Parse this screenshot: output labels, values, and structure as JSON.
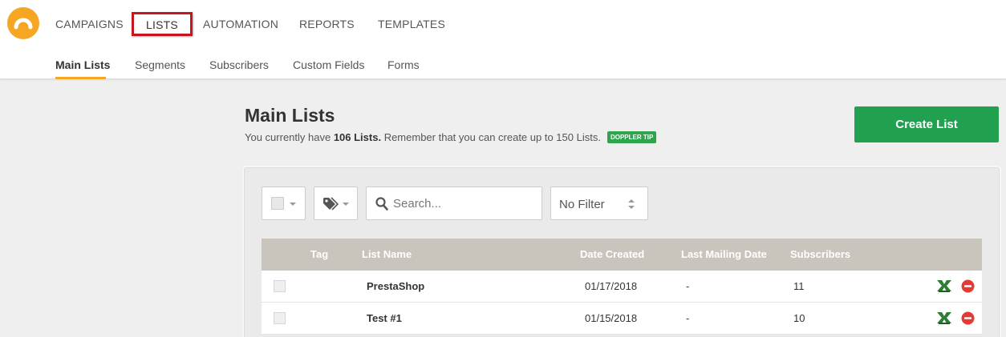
{
  "nav": {
    "items": [
      {
        "label": "CAMPAIGNS"
      },
      {
        "label": "LISTS"
      },
      {
        "label": "AUTOMATION"
      },
      {
        "label": "REPORTS"
      },
      {
        "label": "TEMPLATES"
      }
    ],
    "active": "LISTS"
  },
  "subnav": {
    "items": [
      {
        "label": "Main Lists"
      },
      {
        "label": "Segments"
      },
      {
        "label": "Subscribers"
      },
      {
        "label": "Custom Fields"
      },
      {
        "label": "Forms"
      }
    ],
    "active": "Main Lists"
  },
  "page": {
    "title": "Main Lists",
    "desc_prefix": "You currently have ",
    "desc_count": "106 Lists.",
    "desc_suffix": " Remember that you can create up to 150 Lists.",
    "tip_badge": "DOPPLER TIP",
    "create_button": "Create List"
  },
  "toolbar": {
    "search_placeholder": "Search...",
    "filter_value": "No Filter"
  },
  "table": {
    "headers": {
      "tag": "Tag",
      "name": "List Name",
      "date_created": "Date Created",
      "last_mailing": "Last Mailing Date",
      "subscribers": "Subscribers"
    },
    "rows": [
      {
        "name": "PrestaShop",
        "date_created": "01/17/2018",
        "last_mailing": "-",
        "subscribers": "11"
      },
      {
        "name": "Test #1",
        "date_created": "01/15/2018",
        "last_mailing": "-",
        "subscribers": "10"
      }
    ]
  },
  "colors": {
    "accent": "#f5a623",
    "create_button": "#21a050",
    "table_header": "#c9c5bc",
    "highlight_border": "#c4161c"
  },
  "icons": [
    "logo-icon",
    "tag-icon",
    "search-icon",
    "updown-icon",
    "excel-icon",
    "delete-icon"
  ]
}
